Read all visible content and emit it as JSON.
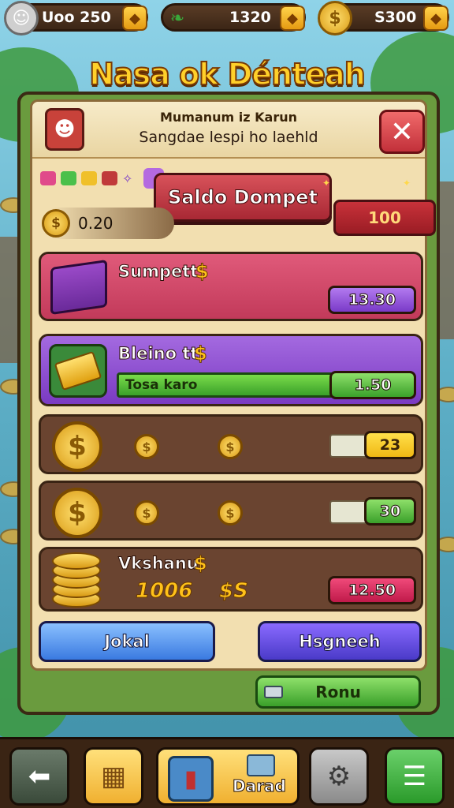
{
  "resources": [
    {
      "value": "Uoo 250",
      "icon": "avatar-icon"
    },
    {
      "value": "1320",
      "icon": "leaf-icon"
    },
    {
      "value": "S300",
      "icon": "coin-icon"
    }
  ],
  "title": "Nasa ok Dénteah",
  "panel": {
    "header_line1": "Mumanum iz Karun",
    "header_line2": "Sangdae lespi ho laehld",
    "close_symbol": "✕",
    "banner": "Saldo Dompet",
    "balance_value": "0.20",
    "balance_right": "100"
  },
  "items": [
    {
      "label": "Sumpett",
      "price": "13.30"
    },
    {
      "label": "Bleino tt",
      "bar_text": "Tosa karo",
      "price": "1.50"
    },
    {
      "price": "23"
    },
    {
      "price": "30"
    },
    {
      "label": "Vkshanu",
      "amount": "1006",
      "amount2": "$S",
      "price": "12.50"
    }
  ],
  "buttons": {
    "left": "Jokal",
    "right": "Hsgneeh",
    "bottom": "Ronu"
  },
  "nav": {
    "wide_label": "Darad"
  },
  "colors": {
    "title": "#ffd02a",
    "panel": "#6a9b3e",
    "pink_card": "#e05a7a",
    "purple_card": "#a46ae0"
  }
}
